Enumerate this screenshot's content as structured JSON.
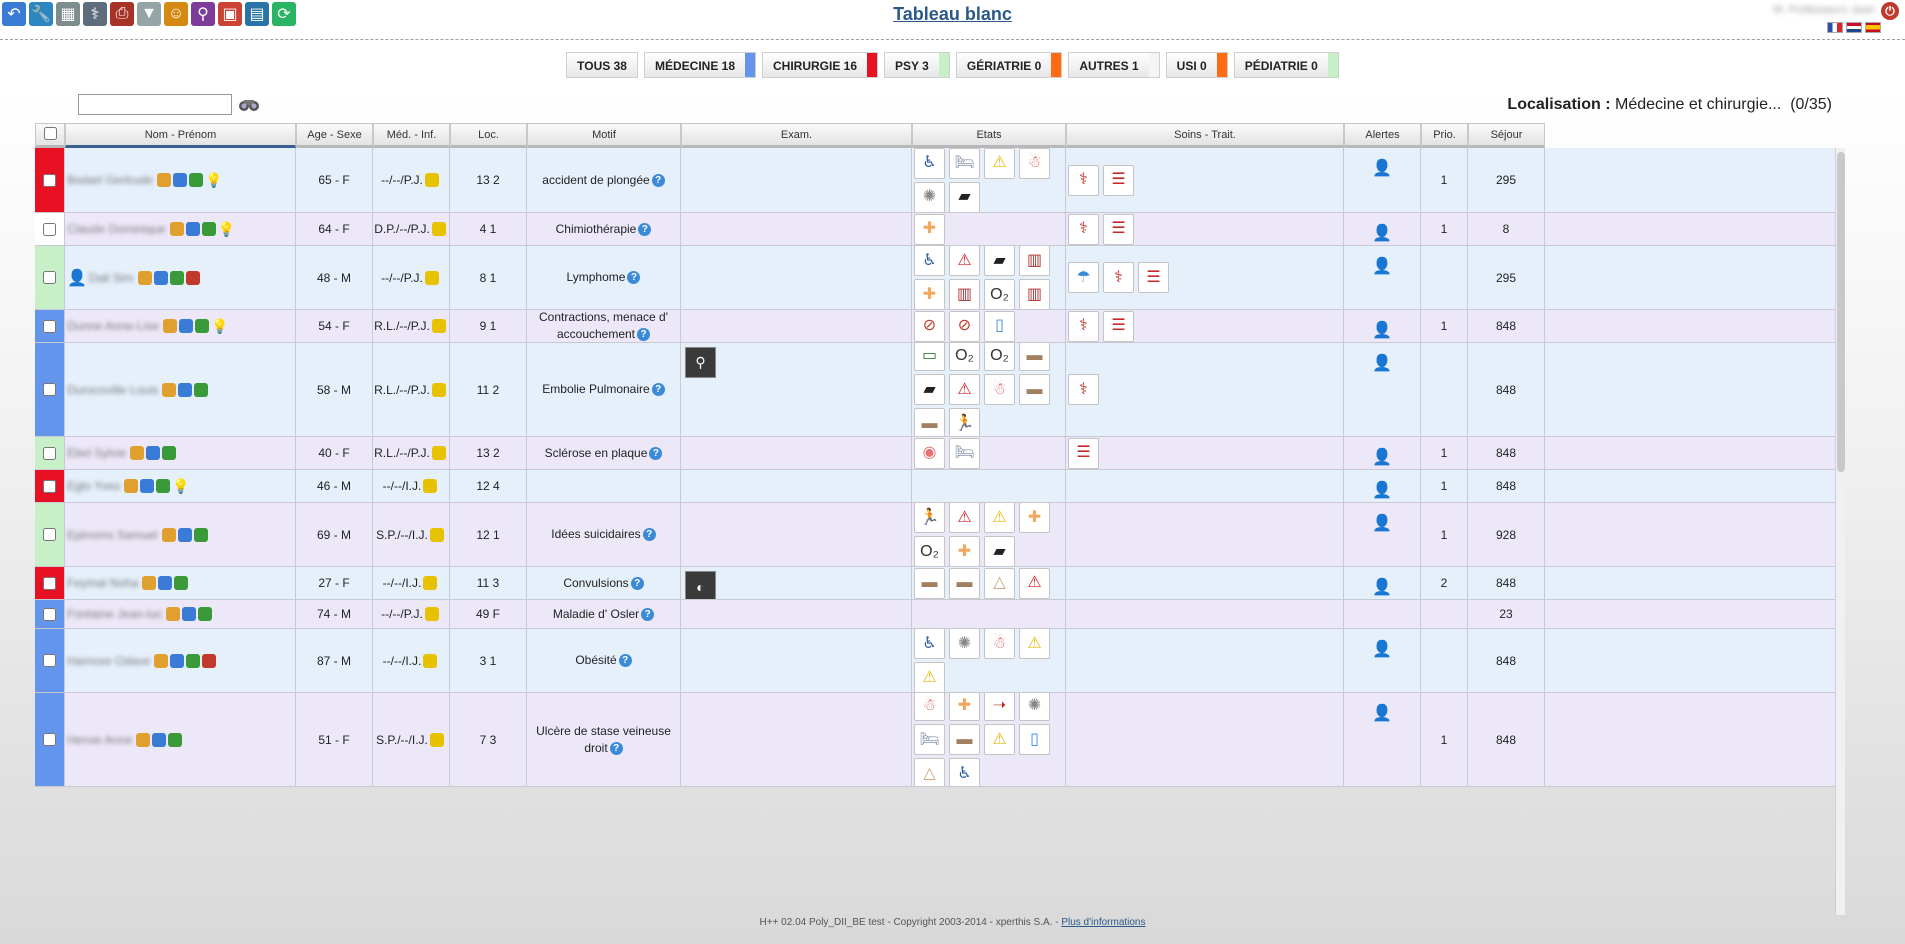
{
  "header": {
    "title": "Tableau blanc",
    "user_name": "M. Professeur1 Jean",
    "toolbar_icons": [
      {
        "name": "back-icon",
        "color": "#3a7bd5",
        "glyph": "↶"
      },
      {
        "name": "wrench-icon",
        "color": "#2e86c1",
        "glyph": "🔧"
      },
      {
        "name": "layout-grid-icon",
        "color": "#7f8c8d",
        "glyph": "▦"
      },
      {
        "name": "stethoscope-icon",
        "color": "#5d6d7e",
        "glyph": "⚕"
      },
      {
        "name": "printer-icon",
        "color": "#a93226",
        "glyph": "⎙"
      },
      {
        "name": "filter-icon",
        "color": "#95a5a6",
        "glyph": "▼"
      },
      {
        "name": "users-icon",
        "color": "#d68910",
        "glyph": "☺"
      },
      {
        "name": "user-search-icon",
        "color": "#7d3c98",
        "glyph": "⚲"
      },
      {
        "name": "box-icon",
        "color": "#cb4335",
        "glyph": "▣"
      },
      {
        "name": "calendar-icon",
        "color": "#2874a6",
        "glyph": "▤"
      },
      {
        "name": "refresh-icon",
        "color": "#28b463",
        "glyph": "⟳"
      }
    ],
    "flags": [
      "fr",
      "nl",
      "es"
    ]
  },
  "tabs": [
    {
      "label": "TOUS 38",
      "color": ""
    },
    {
      "label": "MÉDECINE 18",
      "color": "#6495ed"
    },
    {
      "label": "CHIRURGIE 16",
      "color": "#e81123"
    },
    {
      "label": "PSY 3",
      "color": "#c8f0c8"
    },
    {
      "label": "GÉRIATRIE 0",
      "color": "#ff6a13"
    },
    {
      "label": "AUTRES 1",
      "color": "#f4f4f4"
    },
    {
      "label": "USI 0",
      "color": "#ff6a13"
    },
    {
      "label": "PÉDIATRIE 0",
      "color": "#c8f0c8"
    }
  ],
  "search": {
    "value": "",
    "placeholder": ""
  },
  "localisation": {
    "label": "Localisation :",
    "value": "Médecine et chirurgie...",
    "count": "(0/35)"
  },
  "table": {
    "columns": [
      {
        "key": "check",
        "label": ""
      },
      {
        "key": "name",
        "label": "Nom - Prénom"
      },
      {
        "key": "age",
        "label": "Age - Sexe"
      },
      {
        "key": "med",
        "label": "Méd. - Inf."
      },
      {
        "key": "loc",
        "label": "Loc."
      },
      {
        "key": "motif",
        "label": "Motif"
      },
      {
        "key": "exam",
        "label": "Exam."
      },
      {
        "key": "etats",
        "label": "Etats"
      },
      {
        "key": "soins",
        "label": "Soins - Trait."
      },
      {
        "key": "alertes",
        "label": "Alertes"
      },
      {
        "key": "prio",
        "label": "Prio."
      },
      {
        "key": "sejour",
        "label": "Séjour"
      }
    ],
    "rows": [
      {
        "name": "Bodart Gertrude",
        "age": "65 - F",
        "med": "--/--/P.J.",
        "loc": "13 2",
        "motif": "accident de plongée",
        "sejour": "295",
        "prio": "1",
        "color": "#e81123",
        "bg": "#e6f0fb",
        "etats": [
          "wheelchair",
          "bed",
          "warning-yellow",
          "body",
          "stone",
          "dark-mat"
        ],
        "soins": [
          "drip",
          "drip-list"
        ],
        "exam": [],
        "alert": true,
        "bulb": true,
        "extra_avatar": false
      },
      {
        "name": "Claude Dominique",
        "age": "64 - F",
        "med": "D.P./--/P.J.",
        "loc": "4 1",
        "motif": "Chimiothérapie",
        "sejour": "8",
        "prio": "1",
        "color": "#ffffff",
        "bg": "#ede8f8",
        "etats": [
          "bandage"
        ],
        "soins": [
          "drip",
          "drip-list"
        ],
        "exam": [],
        "alert": true,
        "bulb": true,
        "extra_avatar": false
      },
      {
        "name": "Dali Sim",
        "age": "48 - M",
        "med": "--/--/P.J.",
        "loc": "8 1",
        "motif": "Lymphome",
        "sejour": "295",
        "prio": "",
        "color": "#c8f0c8",
        "bg": "#e6f0fb",
        "etats": [
          "wheelchair",
          "warning-red",
          "dark-mat",
          "crib",
          "bandage",
          "crib",
          "oxygen",
          "crib"
        ],
        "soins": [
          "shower",
          "drip",
          "drip-list"
        ],
        "exam": [],
        "alert": true,
        "bulb": false,
        "extra_avatar": true
      },
      {
        "name": "Dunne Anne-Lise",
        "age": "54 - F",
        "med": "R.L./--/P.J.",
        "loc": "9 1",
        "motif": "Contractions, menace d' accouchement",
        "sejour": "848",
        "prio": "1",
        "color": "#6495ed",
        "bg": "#ede8f8",
        "etats": [
          "no-food",
          "no-food",
          "water"
        ],
        "soins": [
          "drip",
          "drip-list"
        ],
        "exam": [],
        "alert": true,
        "bulb": true,
        "extra_avatar": false
      },
      {
        "name": "Durocoville Louis",
        "age": "58 - M",
        "med": "R.L./--/P.J.",
        "loc": "11 2",
        "motif": "Embolie Pulmonaire",
        "sejour": "848",
        "prio": "",
        "color": "#6495ed",
        "bg": "#e6f0fb",
        "etats": [
          "monitor",
          "oxygen",
          "oxygen",
          "bed-small",
          "dark-mat",
          "warning-red",
          "body",
          "bed-small",
          "bed-small",
          "runner"
        ],
        "soins": [
          "drip"
        ],
        "exam": [
          "lungs"
        ],
        "alert": true,
        "bulb": false,
        "extra_avatar": false
      },
      {
        "name": "Ebel Sylvie",
        "age": "40 - F",
        "med": "R.L./--/P.J.",
        "loc": "13 2",
        "motif": "Sclérose en plaque",
        "sejour": "848",
        "prio": "1",
        "color": "#c8f0c8",
        "bg": "#ede8f8",
        "etats": [
          "mouth",
          "bed"
        ],
        "soins": [
          "drip-list"
        ],
        "exam": [],
        "alert": true,
        "bulb": false,
        "extra_avatar": false
      },
      {
        "name": "Eglo Yves",
        "age": "46 - M",
        "med": "--/--/I.J.",
        "loc": "12 4",
        "motif": "",
        "sejour": "848",
        "prio": "1",
        "color": "#e81123",
        "bg": "#e6f0fb",
        "etats": [],
        "soins": [],
        "exam": [],
        "alert": true,
        "bulb": true,
        "extra_avatar": false
      },
      {
        "name": "Epinoms Samuel",
        "age": "69 - M",
        "med": "S.P./--/I.J.",
        "loc": "12 1",
        "motif": "Idées suicidaires",
        "sejour": "928",
        "prio": "1",
        "color": "#c8f0c8",
        "bg": "#ede8f8",
        "etats": [
          "runner",
          "warning-red",
          "warning-yellow",
          "bandage",
          "oxygen",
          "bandage",
          "dark-mat"
        ],
        "soins": [],
        "exam": [],
        "alert": true,
        "bulb": false,
        "extra_avatar": false
      },
      {
        "name": "Feymal Noha",
        "age": "27 - F",
        "med": "--/--/I.J.",
        "loc": "11 3",
        "motif": "Convulsions",
        "sejour": "848",
        "prio": "2",
        "color": "#e81123",
        "bg": "#e6f0fb",
        "etats": [
          "bed-small",
          "bed-small",
          "nose",
          "warning-red"
        ],
        "soins": [],
        "exam": [
          "echo"
        ],
        "alert": true,
        "bulb": false,
        "extra_avatar": false
      },
      {
        "name": "Fontaine Jean-luc",
        "age": "74 - M",
        "med": "--/--/P.J.",
        "loc": "49 F",
        "motif": "Maladie d' Osler",
        "sejour": "23",
        "prio": "",
        "color": "#6495ed",
        "bg": "#ede8f8",
        "etats": [],
        "soins": [],
        "exam": [],
        "alert": false,
        "bulb": false,
        "extra_avatar": false
      },
      {
        "name": "Hamoxe Odave",
        "age": "87 - M",
        "med": "--/--/I.J.",
        "loc": "3 1",
        "motif": "Obésité",
        "sejour": "848",
        "prio": "",
        "color": "#6495ed",
        "bg": "#e6f0fb",
        "etats": [
          "wheelchair",
          "stone",
          "body",
          "warning-yellow",
          "warning-yellow"
        ],
        "soins": [],
        "exam": [],
        "alert": true,
        "bulb": false,
        "extra_avatar": true
      },
      {
        "name": "Hervie Anne",
        "age": "51 - F",
        "med": "S.P./--/I.J.",
        "loc": "7 3",
        "motif": "Ulcère de stase veineuse droit",
        "sejour": "848",
        "prio": "1",
        "color": "#6495ed",
        "bg": "#ede8f8",
        "etats": [
          "body",
          "bandage",
          "syringe-arrow",
          "stone",
          "bed",
          "bed-small",
          "warning-yellow",
          "water",
          "nose",
          "wheelchair"
        ],
        "soins": [],
        "exam": [],
        "alert": true,
        "bulb": false,
        "extra_avatar": false
      }
    ]
  },
  "footer": {
    "text": "H++ 02.04 Poly_DII_BE test - Copyright 2003-2014 - xperthis S.A. -",
    "link": "Plus d'informations"
  }
}
